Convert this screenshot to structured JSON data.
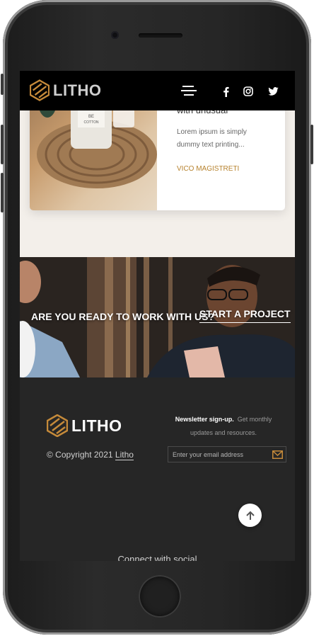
{
  "header": {
    "logo_text": "LITHO",
    "menu_icon": "hamburger-menu-icon",
    "social": [
      {
        "name": "facebook-icon",
        "glyph": "f"
      },
      {
        "name": "instagram-icon",
        "glyph": "instagram"
      },
      {
        "name": "twitter-icon",
        "glyph": "twitter"
      }
    ]
  },
  "card": {
    "title_fragment": "with unusual",
    "description": "Lorem ipsum is simply dummy text printing...",
    "author": "VICO MAGISTRETI",
    "image_label": "BE COTTON"
  },
  "banner": {
    "headline": "ARE YOU READY TO WORK WITH US?",
    "cta": "START A PROJECT"
  },
  "footer": {
    "logo_text": "LITHO",
    "copyright_prefix": "© Copyright 2021",
    "copyright_link": "Litho",
    "newsletter_title": "Newsletter sign-up.",
    "newsletter_text": "Get monthly updates and resources.",
    "email_placeholder": "Enter your email address",
    "connect_text": "Connect with social"
  },
  "colors": {
    "accent": "#b7832f",
    "header_bg": "#000000",
    "footer_bg": "#262626",
    "page_bg": "#f3efea"
  }
}
